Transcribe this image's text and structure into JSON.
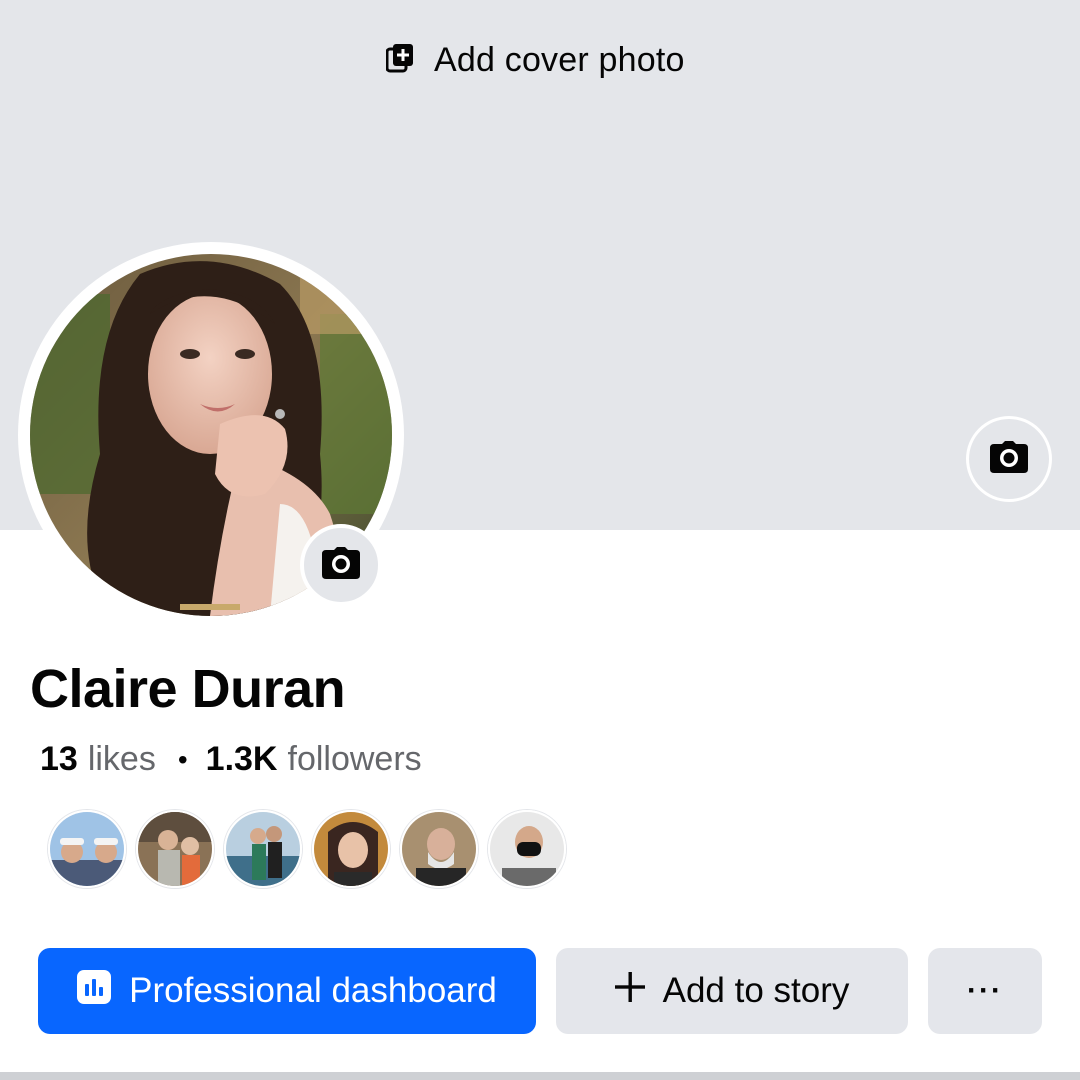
{
  "cover": {
    "add_cover_label": "Add cover photo",
    "bg_color": "#e4e6ea"
  },
  "profile": {
    "name": "Claire Duran",
    "likes_count": "13",
    "likes_label": "likes",
    "followers_count": "1.3K",
    "followers_label": "followers",
    "separator": "•"
  },
  "followers_preview": [
    {
      "icon": "follower-avatar-1"
    },
    {
      "icon": "follower-avatar-2"
    },
    {
      "icon": "follower-avatar-3"
    },
    {
      "icon": "follower-avatar-4"
    },
    {
      "icon": "follower-avatar-5"
    },
    {
      "icon": "follower-avatar-6"
    }
  ],
  "actions": {
    "professional_dashboard_label": "Professional dashboard",
    "add_to_story_label": "Add to story",
    "more_label": "···"
  },
  "colors": {
    "primary": "#0866ff",
    "secondary_button": "#e4e6eb",
    "text": "#050505",
    "muted_text": "#65676b"
  }
}
